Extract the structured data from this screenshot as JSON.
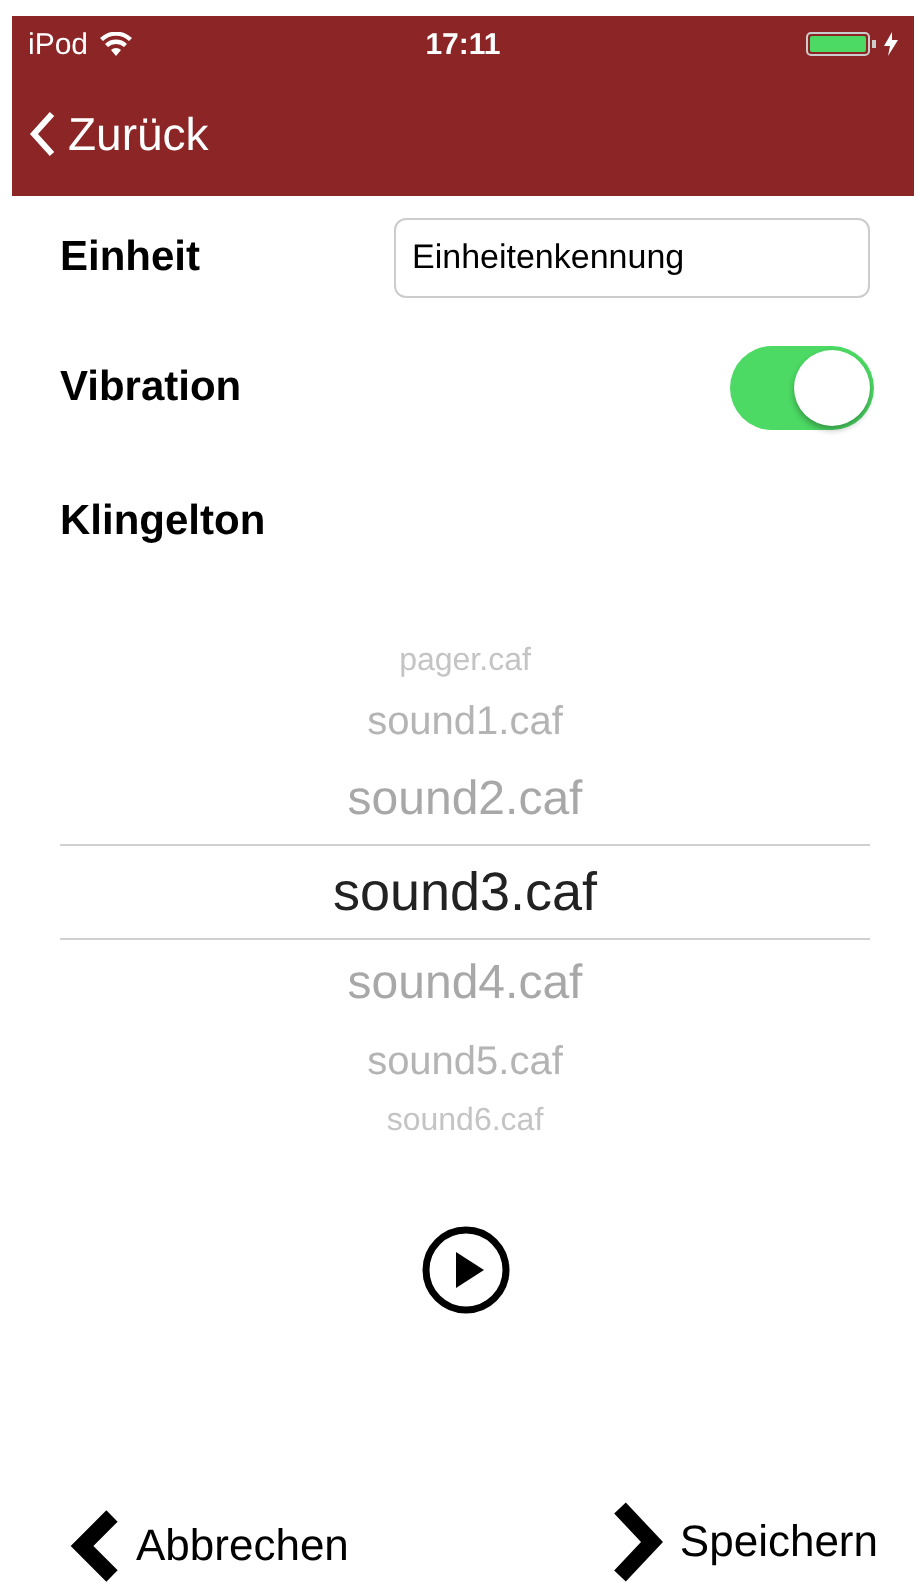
{
  "status_bar": {
    "device": "iPod",
    "time": "17:11"
  },
  "nav": {
    "back": "Zurück"
  },
  "fields": {
    "unit_label": "Einheit",
    "unit_value": "Einheitenkennung",
    "vibration_label": "Vibration",
    "vibration_on": true,
    "ringtone_label": "Klingelton"
  },
  "picker": [
    {
      "label": "pager.caf",
      "selected": false
    },
    {
      "label": "sound1.caf",
      "selected": false
    },
    {
      "label": "sound2.caf",
      "selected": false
    },
    {
      "label": "sound3.caf",
      "selected": true
    },
    {
      "label": "sound4.caf",
      "selected": false
    },
    {
      "label": "sound5.caf",
      "selected": false
    },
    {
      "label": "sound6.caf",
      "selected": false
    }
  ],
  "footer": {
    "cancel": "Abbrechen",
    "save": "Speichern"
  }
}
